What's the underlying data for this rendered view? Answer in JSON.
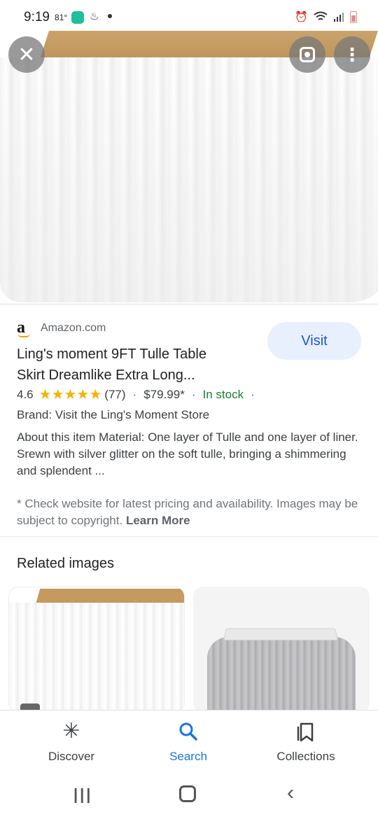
{
  "status_bar": {
    "time": "9:19",
    "temperature": "81°"
  },
  "hero": {
    "close_icon": "close-icon",
    "lens_icon": "lens-icon",
    "more_icon": "more-vert-icon"
  },
  "result": {
    "source": "Amazon.com",
    "source_logo": "a",
    "visit_label": "Visit",
    "title_line1": "Ling's moment 9FT Tulle Table",
    "title_line2": "Skirt Dreamlike Extra Long...",
    "rating": "4.6",
    "stars": 4.6,
    "review_count": "(77)",
    "price": "$79.99*",
    "stock": "In stock",
    "brand": "Brand: Visit the Ling's Moment Store",
    "about": "About this item Material: One layer of Tulle and one layer of liner. Srewn with silver glitter on the soft tulle, bringing a shimmering and splendent ...",
    "disclaimer": "* Check website for latest pricing and availability. Images may be subject to copyright.",
    "learn_more": "Learn More"
  },
  "related": {
    "heading": "Related images"
  },
  "bottom_nav": {
    "discover": "Discover",
    "search": "Search",
    "collections": "Collections"
  },
  "colors": {
    "accent": "#1a73e8",
    "visit_bg": "#e8f0fe",
    "in_stock": "#188038",
    "star": "#f4b400"
  }
}
